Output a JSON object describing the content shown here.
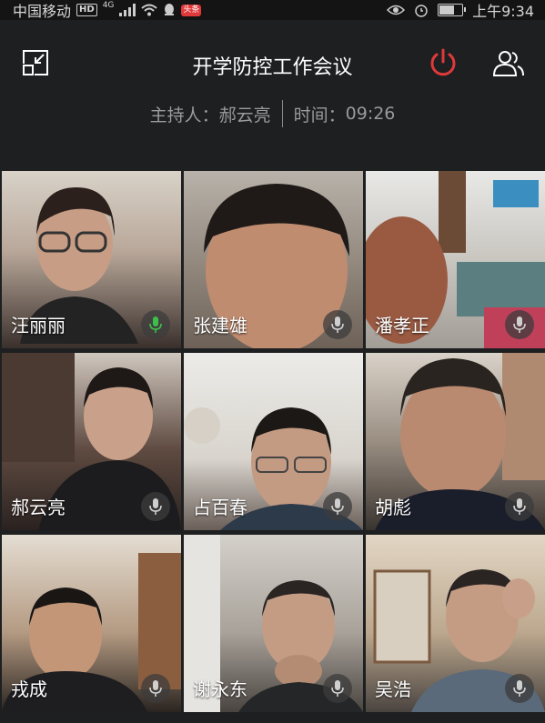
{
  "status_bar": {
    "carrier": "中国移动",
    "hd": "HD",
    "network": "4G",
    "app_badge": "头条",
    "time": "上午9:34"
  },
  "header": {
    "title": "开学防控工作会议",
    "host_label": "主持人：",
    "host_name": "郝云亮",
    "time_label": "时间：",
    "time_value": "09:26"
  },
  "colors": {
    "power": "#e0393a",
    "mic_active": "#3cc04a",
    "mic_idle": "#cfcfcf"
  },
  "participants": [
    {
      "name": "汪丽丽",
      "mic": "active",
      "bg": "#6b5a52"
    },
    {
      "name": "张建雄",
      "mic": "idle",
      "bg": "#7a6a5e"
    },
    {
      "name": "潘孝正",
      "mic": "idle",
      "bg": "#8c8a86"
    },
    {
      "name": "郝云亮",
      "mic": "idle",
      "bg": "#4a3c36"
    },
    {
      "name": "占百春",
      "mic": "idle",
      "bg": "#8a7f78"
    },
    {
      "name": "胡彪",
      "mic": "idle",
      "bg": "#6e665e"
    },
    {
      "name": "戎成",
      "mic": "idle",
      "bg": "#5e4e44"
    },
    {
      "name": "谢永东",
      "mic": "idle",
      "bg": "#7c7670"
    },
    {
      "name": "吴浩",
      "mic": "idle",
      "bg": "#8a7e6e"
    }
  ]
}
